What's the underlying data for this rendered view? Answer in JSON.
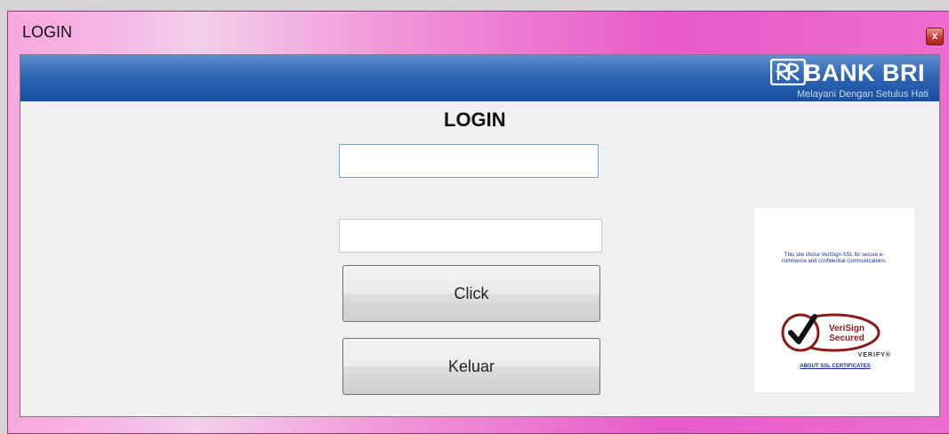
{
  "window": {
    "title": "LOGIN",
    "close_glyph": "x"
  },
  "banner": {
    "logo_text": "BANK BRI",
    "tagline": "Melayani Dengan Setulus Hati"
  },
  "form": {
    "heading": "LOGIN",
    "username_value": "",
    "password_value": "",
    "click_label": "Click",
    "keluar_label": "Keluar"
  },
  "ssl": {
    "description": "This site chose VeriSign SSL for secure e-commerce and confidential communications.",
    "seal_line1": "VeriSign",
    "seal_line2": "Secured",
    "verify": "VERIFY®",
    "about_link": "ABOUT SSL CERTIFICATES"
  },
  "colors": {
    "titlebar_accent": "#f197da",
    "banner_blue": "#2f66b5",
    "seal_red": "#8b1a1a"
  }
}
